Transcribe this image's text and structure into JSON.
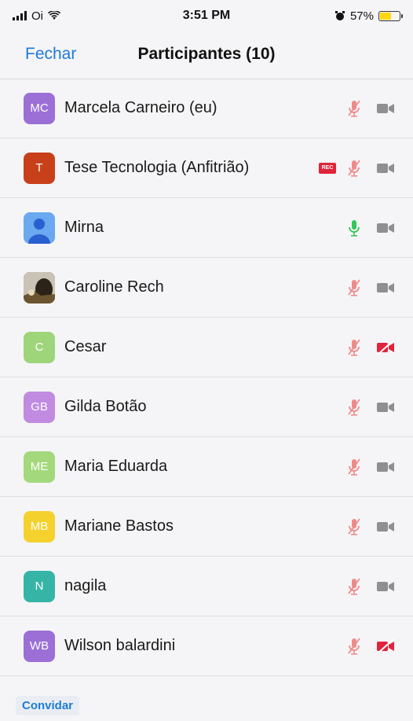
{
  "status_bar": {
    "carrier": "Oi",
    "time": "3:51 PM",
    "battery": "57%",
    "battery_level": 0.57,
    "icons": [
      "signal-icon",
      "wifi-icon",
      "alarm-icon",
      "battery-icon"
    ]
  },
  "nav": {
    "close_label": "Fechar",
    "title": "Participantes (10)"
  },
  "colors": {
    "accent": "#1e7bd8",
    "muted_red": "#f08a8a",
    "video_off_red": "#e0243a",
    "video_gray": "#8e8e93",
    "mic_green": "#34c759"
  },
  "participants": [
    {
      "name": "Marcela Carneiro (eu)",
      "initials": "MC",
      "avatar_color": "#9b6fd6",
      "avatar_type": "initials",
      "mic": "muted",
      "video": "off-gray",
      "rec": false
    },
    {
      "name": "Tese Tecnologia (Anfitrião)",
      "initials": "T",
      "avatar_color": "#c8401a",
      "avatar_type": "initials",
      "mic": "muted",
      "video": "off-gray",
      "rec": true,
      "rec_label": "REC"
    },
    {
      "name": "Mirna",
      "initials": "",
      "avatar_color": "#6aa8f0",
      "avatar_type": "person",
      "mic": "active",
      "video": "off-gray",
      "rec": false
    },
    {
      "name": "Caroline Rech",
      "initials": "",
      "avatar_color": "#3a3a2a",
      "avatar_type": "photo",
      "mic": "muted",
      "video": "off-gray",
      "rec": false
    },
    {
      "name": "Cesar",
      "initials": "C",
      "avatar_color": "#9fd57a",
      "avatar_type": "initials",
      "mic": "muted",
      "video": "off-red",
      "rec": false
    },
    {
      "name": "Gilda Botão",
      "initials": "GB",
      "avatar_color": "#c08be0",
      "avatar_type": "initials",
      "mic": "muted",
      "video": "off-gray",
      "rec": false
    },
    {
      "name": "Maria Eduarda",
      "initials": "ME",
      "avatar_color": "#a3d97c",
      "avatar_type": "initials",
      "mic": "muted",
      "video": "off-gray",
      "rec": false
    },
    {
      "name": "Mariane Bastos",
      "initials": "MB",
      "avatar_color": "#f5d12e",
      "avatar_type": "initials",
      "mic": "muted",
      "video": "off-gray",
      "rec": false
    },
    {
      "name": "nagila",
      "initials": "N",
      "avatar_color": "#36b5a7",
      "avatar_type": "initials",
      "mic": "muted",
      "video": "off-gray",
      "rec": false
    },
    {
      "name": "Wilson balardini",
      "initials": "WB",
      "avatar_color": "#9b6fd6",
      "avatar_type": "initials",
      "mic": "muted",
      "video": "off-red",
      "rec": false
    }
  ],
  "footer": {
    "invite_label": "Convidar"
  }
}
